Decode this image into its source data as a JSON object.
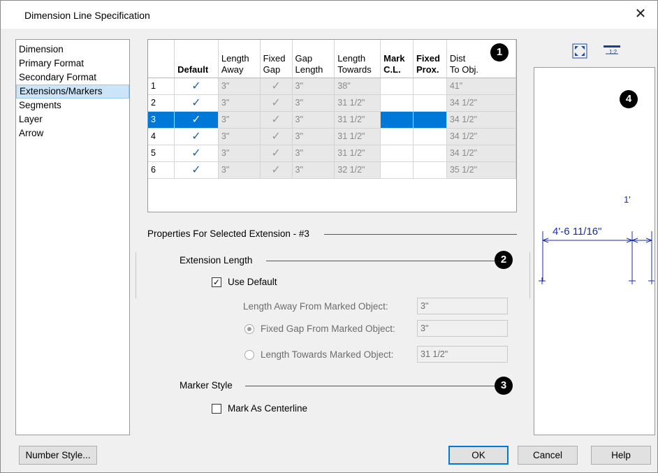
{
  "window": {
    "title": "Dimension Line Specification",
    "close_glyph": "✕"
  },
  "nav": {
    "items": [
      {
        "label": "Dimension"
      },
      {
        "label": "Primary Format"
      },
      {
        "label": "Secondary Format"
      },
      {
        "label": "Extensions/Markers",
        "selected": true
      },
      {
        "label": "Segments"
      },
      {
        "label": "Layer"
      },
      {
        "label": "Arrow"
      }
    ]
  },
  "grid": {
    "columns": [
      {
        "line1": "",
        "line2": "",
        "bold": false
      },
      {
        "line1": "",
        "line2": "Default",
        "bold": true
      },
      {
        "line1": "Length",
        "line2": "Away",
        "bold": false
      },
      {
        "line1": "Fixed",
        "line2": "Gap",
        "bold": false
      },
      {
        "line1": "Gap",
        "line2": "Length",
        "bold": false
      },
      {
        "line1": "Length",
        "line2": "Towards",
        "bold": false
      },
      {
        "line1": "Mark",
        "line2": "C.L.",
        "bold": true
      },
      {
        "line1": "Fixed",
        "line2": "Prox.",
        "bold": true
      },
      {
        "line1": "Dist",
        "line2": "To Obj.",
        "bold": false
      }
    ],
    "check_glyph": "✓",
    "selected_row": 3,
    "rows": [
      {
        "num": "1",
        "length_away": "3\"",
        "gap_length": "3\"",
        "length_towards": "38\"",
        "dist_to_obj": "41\""
      },
      {
        "num": "2",
        "length_away": "3\"",
        "gap_length": "3\"",
        "length_towards": "31 1/2\"",
        "dist_to_obj": "34 1/2\""
      },
      {
        "num": "3",
        "length_away": "3\"",
        "gap_length": "3\"",
        "length_towards": "31 1/2\"",
        "dist_to_obj": "34 1/2\""
      },
      {
        "num": "4",
        "length_away": "3\"",
        "gap_length": "3\"",
        "length_towards": "31 1/2\"",
        "dist_to_obj": "34 1/2\""
      },
      {
        "num": "5",
        "length_away": "3\"",
        "gap_length": "3\"",
        "length_towards": "31 1/2\"",
        "dist_to_obj": "34 1/2\""
      },
      {
        "num": "6",
        "length_away": "3\"",
        "gap_length": "3\"",
        "length_towards": "32 1/2\"",
        "dist_to_obj": "35 1/2\""
      }
    ]
  },
  "badges": {
    "one": "1",
    "two": "2",
    "three": "3",
    "four": "4"
  },
  "properties": {
    "heading": "Properties For Selected Extension - #3",
    "extension_length": {
      "heading": "Extension Length",
      "use_default_label": "Use Default",
      "use_default_checked": true,
      "length_away_label": "Length Away From Marked Object:",
      "length_away_value": "3\"",
      "fixed_gap_label": "Fixed Gap From Marked Object:",
      "fixed_gap_value": "3\"",
      "fixed_gap_selected": true,
      "length_towards_label": "Length Towards Marked Object:",
      "length_towards_value": "31 1/2\""
    },
    "marker_style": {
      "heading": "Marker Style",
      "mark_centerline_label": "Mark As Centerline",
      "mark_centerline_checked": false
    }
  },
  "preview": {
    "dim_main": "4'-6 11/16\"",
    "dim_small": "1'",
    "line_color": "#1a2ea8"
  },
  "buttons": {
    "number_style": "Number Style...",
    "ok": "OK",
    "cancel": "Cancel",
    "help": "Help"
  },
  "colors": {
    "accent": "#0078d7",
    "check": "#1f5fae"
  }
}
